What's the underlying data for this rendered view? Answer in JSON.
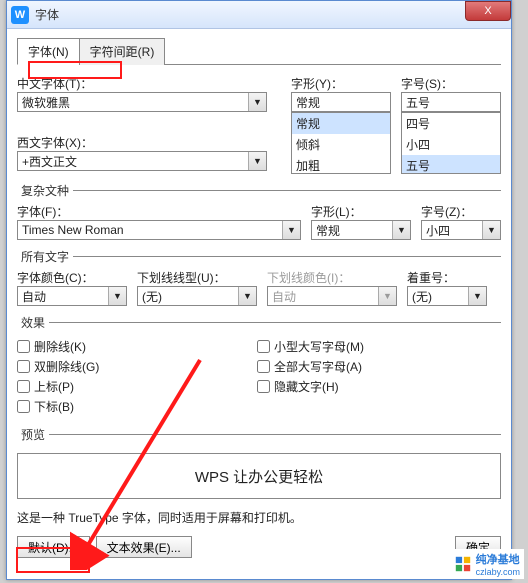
{
  "window": {
    "app_icon_letter": "W",
    "title": "字体",
    "close_label": "X"
  },
  "tabs": {
    "font": "字体(N)",
    "spacing": "字符间距(R)"
  },
  "cn_font": {
    "label": "中文字体(T)：",
    "value": "微软雅黑"
  },
  "style": {
    "label": "字形(Y)：",
    "value": "常规",
    "options": [
      "常规",
      "倾斜",
      "加粗"
    ]
  },
  "size": {
    "label": "字号(S)：",
    "value": "五号",
    "options": [
      "四号",
      "小四",
      "五号"
    ]
  },
  "west_font": {
    "label": "西文字体(X)：",
    "value": "+西文正文"
  },
  "complex": {
    "legend": "复杂文种",
    "font_label": "字体(F)：",
    "font_value": "Times New Roman",
    "style_label": "字形(L)：",
    "style_value": "常规",
    "size_label": "字号(Z)：",
    "size_value": "小四"
  },
  "all_text": {
    "legend": "所有文字",
    "color_label": "字体颜色(C)：",
    "color_value": "自动",
    "underline_label": "下划线线型(U)：",
    "underline_value": "(无)",
    "underline_color_label": "下划线颜色(I)：",
    "underline_color_value": "自动",
    "emphasis_label": "着重号：",
    "emphasis_value": "(无)"
  },
  "effects": {
    "legend": "效果",
    "strike": "删除线(K)",
    "dstrike": "双删除线(G)",
    "super": "上标(P)",
    "sub": "下标(B)",
    "smallcaps": "小型大写字母(M)",
    "allcaps": "全部大写字母(A)",
    "hidden": "隐藏文字(H)"
  },
  "preview": {
    "legend": "预览",
    "text": "WPS 让办公更轻松",
    "note": "这是一种 TrueType 字体，同时适用于屏幕和打印机。"
  },
  "buttons": {
    "default": "默认(D)...",
    "texteffect": "文本效果(E)...",
    "ok": "确定"
  },
  "watermark": {
    "brand": "纯净基地",
    "url": "czlaby.com"
  }
}
